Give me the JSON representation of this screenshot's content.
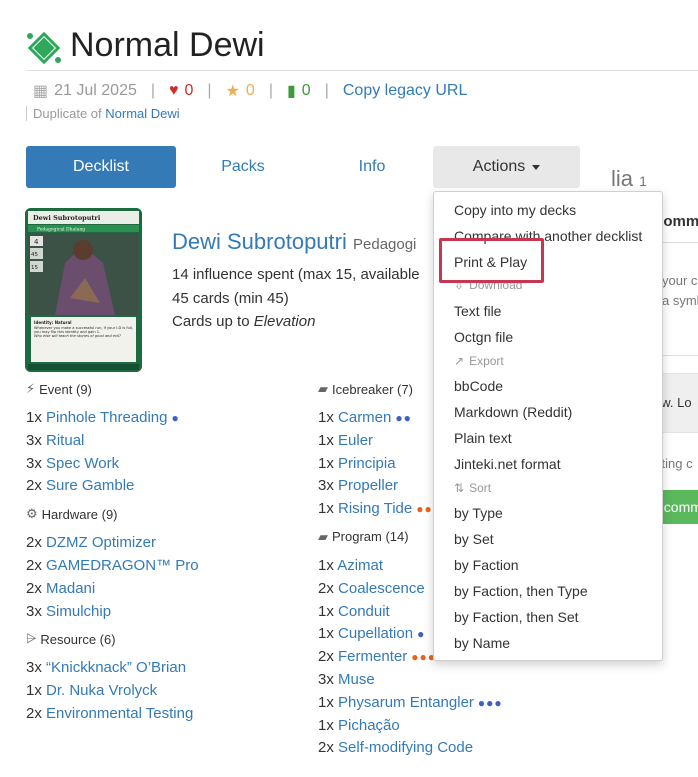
{
  "deck": {
    "title": "Normal Dewi",
    "date": "21 Jul 2025",
    "likes": "0",
    "favorites": "0",
    "comments": "0",
    "copy_link": "Copy legacy URL",
    "duplicate_prefix": "Duplicate of",
    "duplicate_link": "Normal Dewi"
  },
  "tabs": {
    "decklist": "Decklist",
    "packs": "Packs",
    "info": "Info",
    "actions": "Actions"
  },
  "side": {
    "author": "lia",
    "author_rep": "1",
    "comment_hint": "comme",
    "text1": "your c",
    "text2": "a symb",
    "text3": "ew. Lo",
    "text4": "itting c",
    "button": "t comm"
  },
  "identity": {
    "name": "Dewi Subrotoputri",
    "faction": "Pedagogi",
    "influence": "14 influence spent (max 15, available",
    "cards": "45 cards (min 45)",
    "cards_up_to_prefix": "Cards up to",
    "cards_up_to_set": "Elevation"
  },
  "card_image": {
    "name": "Dewi Subrotoputri",
    "subtitle": "Pedagogical Dhalang",
    "link": "4",
    "min_deck": "45",
    "influence": "15",
    "type": "Identity: Natural",
    "text": "Whenever you make a successful run, if your I.D is full, you may flip this identity and gain 1.",
    "flavor": "Who else will teach the stories of good and evil?"
  },
  "sections_left": [
    {
      "name": "Event (9)",
      "icon": "event-icon",
      "glyph": "⚡",
      "cards": [
        {
          "qty": "1x",
          "name": "Pinhole Threading",
          "dots": "●",
          "dot_color": "blue"
        },
        {
          "qty": "3x",
          "name": "Ritual",
          "dots": "",
          "dot_color": ""
        },
        {
          "qty": "3x",
          "name": "Spec Work",
          "dots": "",
          "dot_color": ""
        },
        {
          "qty": "2x",
          "name": "Sure Gamble",
          "dots": "",
          "dot_color": ""
        }
      ]
    },
    {
      "name": "Hardware (9)",
      "icon": "hardware-icon",
      "glyph": "⚙",
      "cards": [
        {
          "qty": "2x",
          "name": "DZMZ Optimizer",
          "dots": "",
          "dot_color": ""
        },
        {
          "qty": "2x",
          "name": "GAMEDRAGON™ Pro",
          "dots": "",
          "dot_color": ""
        },
        {
          "qty": "2x",
          "name": "Madani",
          "dots": "",
          "dot_color": ""
        },
        {
          "qty": "3x",
          "name": "Simulchip",
          "dots": "",
          "dot_color": ""
        }
      ]
    },
    {
      "name": "Resource (6)",
      "icon": "resource-icon",
      "glyph": "⩥",
      "cards": [
        {
          "qty": "3x",
          "name": "“Knickknack” O’Brian",
          "dots": "",
          "dot_color": ""
        },
        {
          "qty": "1x",
          "name": "Dr. Nuka Vrolyck",
          "dots": "",
          "dot_color": ""
        },
        {
          "qty": "2x",
          "name": "Environmental Testing",
          "dots": "",
          "dot_color": ""
        }
      ]
    }
  ],
  "sections_right": [
    {
      "name": "Icebreaker (7)",
      "icon": "program-icon",
      "glyph": "▰",
      "cards": [
        {
          "qty": "1x",
          "name": "Carmen",
          "dots": "●●",
          "dot_color": "blue"
        },
        {
          "qty": "1x",
          "name": "Euler",
          "dots": "",
          "dot_color": ""
        },
        {
          "qty": "1x",
          "name": "Principia",
          "dots": "",
          "dot_color": ""
        },
        {
          "qty": "3x",
          "name": "Propeller",
          "dots": "",
          "dot_color": ""
        },
        {
          "qty": "1x",
          "name": "Rising Tide",
          "dots": "●●",
          "dot_color": "orange"
        }
      ]
    },
    {
      "name": "Program (14)",
      "icon": "program-icon",
      "glyph": "▰",
      "cards": [
        {
          "qty": "1x",
          "name": "Azimat",
          "dots": "",
          "dot_color": ""
        },
        {
          "qty": "2x",
          "name": "Coalescence",
          "dots": "",
          "dot_color": ""
        },
        {
          "qty": "1x",
          "name": "Conduit",
          "dots": "",
          "dot_color": ""
        },
        {
          "qty": "1x",
          "name": "Cupellation",
          "dots": "●",
          "dot_color": "blue"
        },
        {
          "qty": "2x",
          "name": "Fermenter",
          "dots": "●●●●",
          "dot_color": "orange"
        },
        {
          "qty": "3x",
          "name": "Muse",
          "dots": "",
          "dot_color": ""
        },
        {
          "qty": "1x",
          "name": "Physarum Entangler",
          "dots": "●●●",
          "dot_color": "blue"
        },
        {
          "qty": "1x",
          "name": "Pichação",
          "dots": "",
          "dot_color": ""
        },
        {
          "qty": "2x",
          "name": "Self-modifying Code",
          "dots": "",
          "dot_color": ""
        }
      ]
    }
  ],
  "menu": {
    "copy_into": "Copy into my decks",
    "compare": "Compare with another decklist",
    "print_play": "Print & Play",
    "download_header": "Download",
    "text_file": "Text file",
    "octgn_file": "Octgn file",
    "export_header": "Export",
    "bbcode": "bbCode",
    "markdown": "Markdown (Reddit)",
    "plain_text": "Plain text",
    "jinteki": "Jinteki.net format",
    "sort_header": "Sort",
    "by_type": "by Type",
    "by_set": "by Set",
    "by_faction": "by Faction",
    "by_faction_type": "by Faction, then Type",
    "by_faction_set": "by Faction, then Set",
    "by_name": "by Name"
  },
  "colors": {
    "accent": "#337ab7",
    "highlight": "#c73752",
    "faction_green": "#1f9c55",
    "heart": "#c9302c",
    "star": "#f0ad4e",
    "comment": "#3c9a3c"
  }
}
